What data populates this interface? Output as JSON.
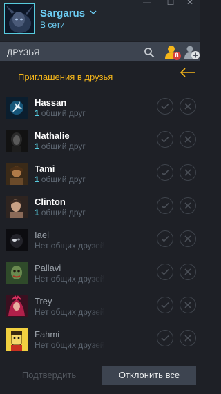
{
  "window": {
    "controls": {
      "minimize": "—",
      "maximize": "☐",
      "close": "✕"
    }
  },
  "user": {
    "name": "Sargarus",
    "status": "В сети",
    "dropdown_icon": "chevron-down-icon"
  },
  "friends_bar": {
    "title": "ДРУЗЬЯ",
    "invites_badge": "8",
    "icons": [
      "search-icon",
      "invites-icon",
      "add-friend-icon"
    ]
  },
  "section": {
    "title": "Приглашения в друзья",
    "back_icon": "back-arrow-icon"
  },
  "colors": {
    "accent_blue": "#6dcff6",
    "section_orange": "#f5b61a",
    "badge_red": "#d9403a",
    "background": "#1e2026"
  },
  "requests": [
    {
      "name": "Hassan",
      "count": "1",
      "text": "общий друг",
      "has_mutual": true
    },
    {
      "name": "Nathalie",
      "count": "1",
      "text": "общий друг",
      "has_mutual": true
    },
    {
      "name": "Tami",
      "count": "1",
      "text": "общий друг",
      "has_mutual": true
    },
    {
      "name": "Clinton",
      "count": "1",
      "text": "общий друг",
      "has_mutual": true
    },
    {
      "name": "Iael",
      "count": "",
      "text": "Нет общих друзей",
      "has_mutual": false
    },
    {
      "name": "Pallavi",
      "count": "",
      "text": "Нет общих друзей",
      "has_mutual": false
    },
    {
      "name": "Trey",
      "count": "",
      "text": "Нет общих друзей",
      "has_mutual": false
    },
    {
      "name": "Fahmi",
      "count": "",
      "text": "Нет общих друзей",
      "has_mutual": false
    }
  ],
  "footer": {
    "confirm_label": "Подтвердить",
    "decline_all_label": "Отклонить все"
  }
}
